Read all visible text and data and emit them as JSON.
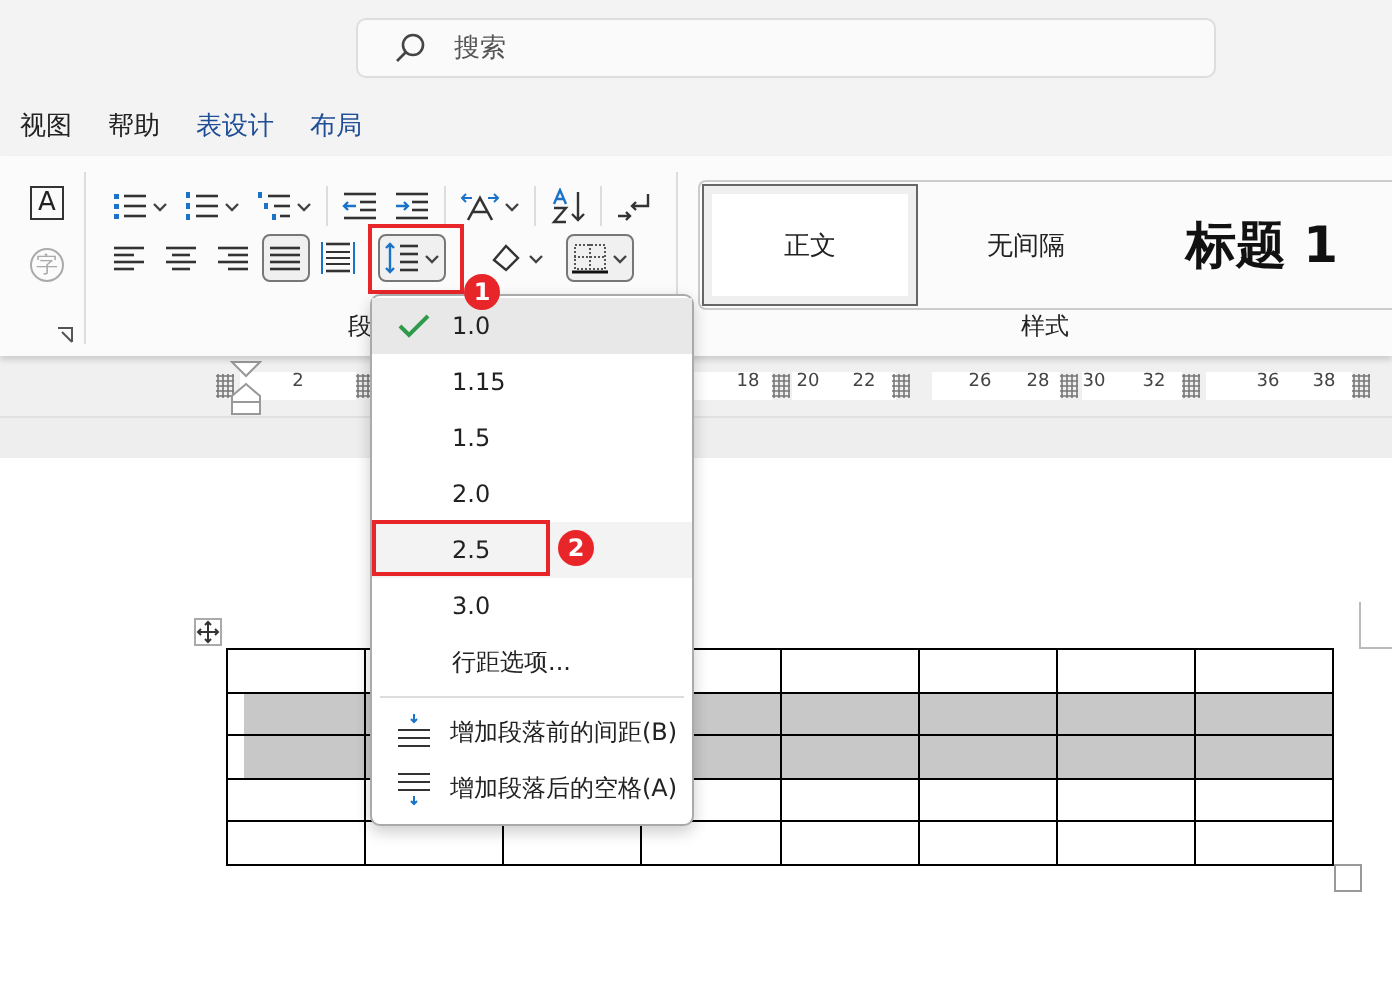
{
  "search": {
    "placeholder": "搜索"
  },
  "menu_tabs": [
    {
      "label": "视图",
      "kind": "normal"
    },
    {
      "label": "帮助",
      "kind": "normal"
    },
    {
      "label": "表设计",
      "kind": "contextual"
    },
    {
      "label": "布局",
      "kind": "contextual"
    }
  ],
  "font_group": {
    "glyphs": [
      {
        "glyph": "A",
        "kind": "boxed"
      },
      {
        "glyph": "字",
        "kind": "circled"
      }
    ]
  },
  "paragraph_group": {
    "label": "段",
    "alignment_buttons": [
      {
        "kind": "left",
        "selected": false
      },
      {
        "kind": "center",
        "selected": false
      },
      {
        "kind": "right",
        "selected": false
      },
      {
        "kind": "justify",
        "selected": true
      },
      {
        "kind": "distributed",
        "selected": false
      }
    ],
    "line_spacing_button": {
      "pressed": true,
      "callout": "1"
    }
  },
  "styles_group": {
    "label": "样式",
    "styles": [
      {
        "label": "正文",
        "kind": "normal",
        "selected": true
      },
      {
        "label": "无间隔",
        "kind": "normal",
        "selected": false
      },
      {
        "label": "标题 1",
        "kind": "heading",
        "selected": false
      }
    ]
  },
  "ruler": {
    "labels": [
      "2",
      "18",
      "20",
      "22",
      "26",
      "28",
      "30",
      "32",
      "36",
      "38"
    ]
  },
  "line_spacing_menu": {
    "items": [
      {
        "label": "1.0",
        "checked": true,
        "selected": true,
        "hovered": false
      },
      {
        "label": "1.15",
        "checked": false,
        "selected": false,
        "hovered": false
      },
      {
        "label": "1.5",
        "checked": false,
        "selected": false,
        "hovered": false
      },
      {
        "label": "2.0",
        "checked": false,
        "selected": false,
        "hovered": false
      },
      {
        "label": "2.5",
        "checked": false,
        "selected": false,
        "hovered": true,
        "callout": "2"
      },
      {
        "label": "3.0",
        "checked": false,
        "selected": false,
        "hovered": false
      },
      {
        "label": "行距选项...",
        "checked": false,
        "selected": false,
        "hovered": false
      }
    ],
    "actions": [
      {
        "label": "增加段落前的间距(B)",
        "kind": "before"
      },
      {
        "label": "增加段落后的空格(A)",
        "kind": "after"
      }
    ]
  },
  "table": {
    "rows": [
      {
        "selected": false
      },
      {
        "selected": true
      },
      {
        "selected": true
      },
      {
        "selected": false
      },
      {
        "selected": false
      }
    ]
  }
}
